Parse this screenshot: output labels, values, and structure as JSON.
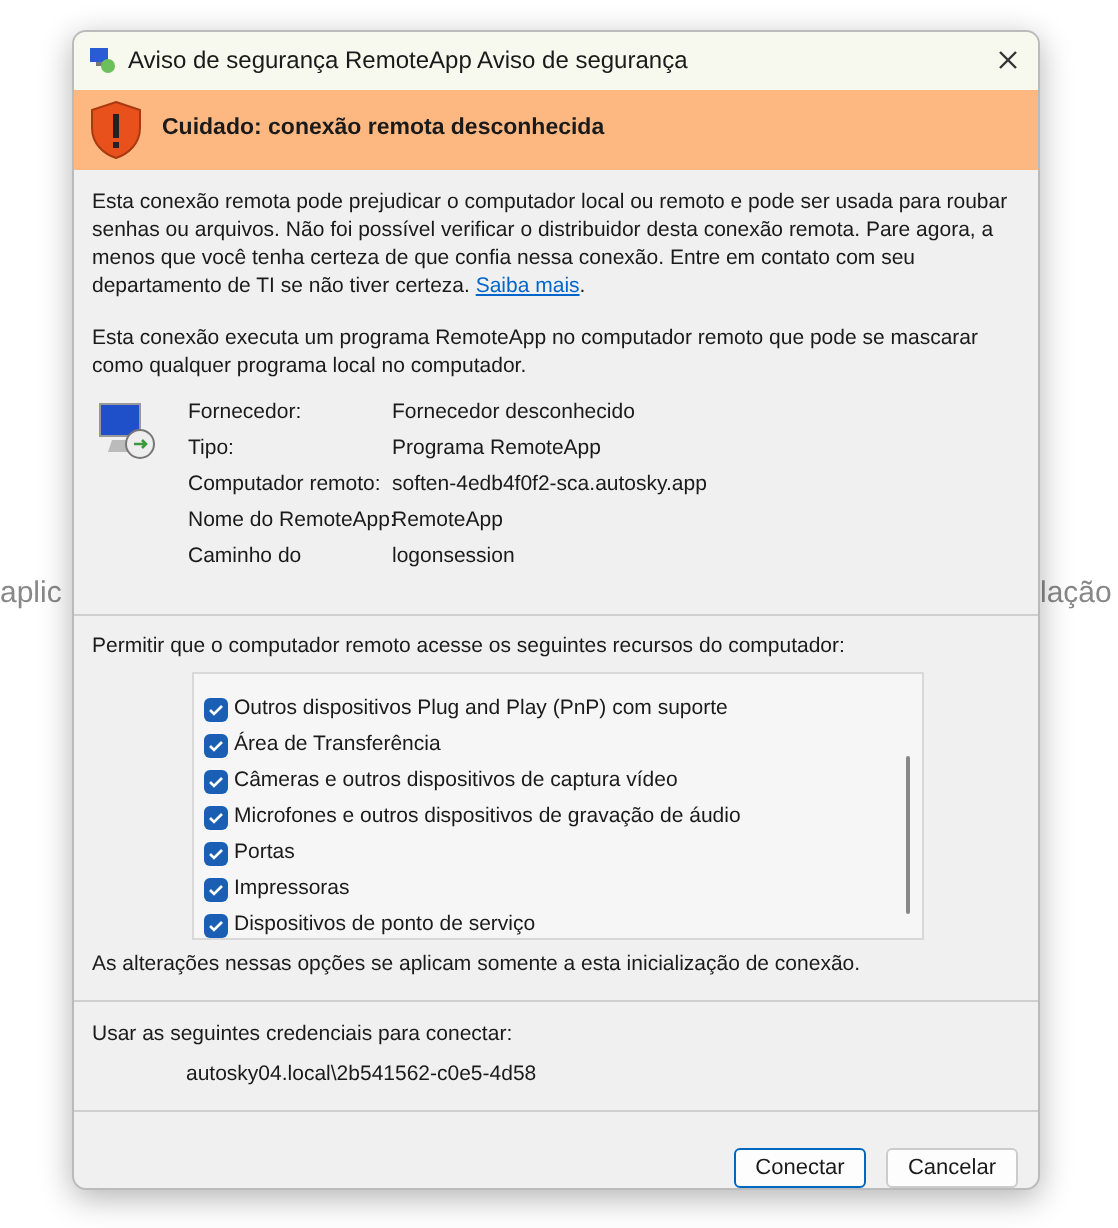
{
  "window": {
    "title": "Aviso de segurança RemoteApp Aviso de segurança"
  },
  "background_texts": [
    "aplic",
    "lação"
  ],
  "warning": {
    "title": "Cuidado: conexão remota desconhecida"
  },
  "description": {
    "text": "Esta conexão remota pode prejudicar o computador local ou remoto e pode ser usada para roubar senhas ou arquivos. Não foi possível verificar o distribuidor desta conexão remota. Pare agora, a menos que você tenha certeza de que confia nessa conexão. Entre em contato com seu departamento de TI se não tiver certeza.",
    "link": "Saiba mais",
    "end": "."
  },
  "note": "Esta conexão executa um programa RemoteApp no computador remoto que pode se mascarar como qualquer programa local no computador.",
  "details": [
    {
      "label": "Fornecedor:",
      "value": "Fornecedor desconhecido"
    },
    {
      "label": "Tipo:",
      "value": "Programa RemoteApp"
    },
    {
      "label": "Computador remoto:",
      "value": "soften-4edb4f0f2-sca.autosky.app"
    },
    {
      "label": "Nome do RemoteApp:",
      "value": "RemoteApp"
    },
    {
      "label": "Caminho do",
      "value": "logonsession"
    }
  ],
  "resources": {
    "label": "Permitir que o computador remoto acesse os seguintes recursos do computador:",
    "items": [
      {
        "label": "Outros dispositivos Plug and Play (PnP) com suporte",
        "checked": true
      },
      {
        "label": "Área de Transferência",
        "checked": true
      },
      {
        "label": "Câmeras e outros dispositivos de captura vídeo",
        "checked": true
      },
      {
        "label": "Microfones e outros dispositivos de gravação de áudio",
        "checked": true
      },
      {
        "label": "Portas",
        "checked": true
      },
      {
        "label": "Impressoras",
        "checked": true
      },
      {
        "label": "Dispositivos de ponto de serviço",
        "checked": true
      }
    ],
    "footnote": "As alterações nessas opções se aplicam somente a esta inicialização de conexão."
  },
  "credentials": {
    "label": "Usar as seguintes credenciais para conectar:",
    "user": "autosky04.local\\2b541562-c0e5-4d58"
  },
  "buttons": [
    {
      "label": "Conectar",
      "default": true
    },
    {
      "label": "Cancelar",
      "default": false
    }
  ]
}
